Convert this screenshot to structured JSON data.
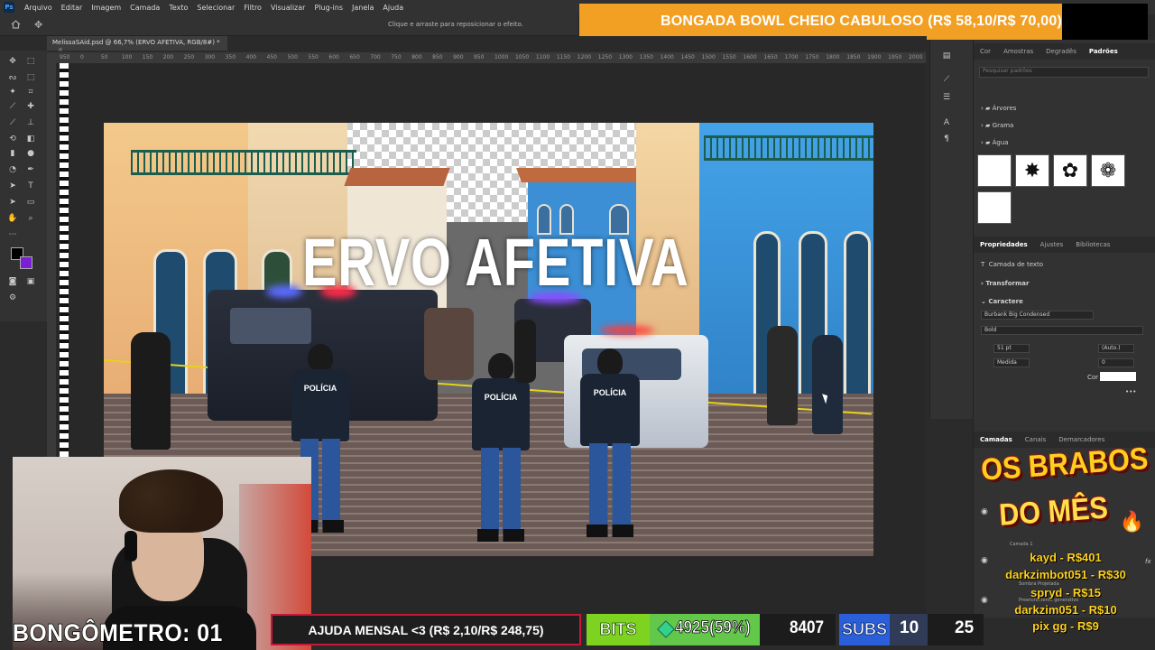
{
  "menubar": {
    "items": [
      "Arquivo",
      "Editar",
      "Imagem",
      "Camada",
      "Texto",
      "Selecionar",
      "Filtro",
      "Visualizar",
      "Plug-ins",
      "Janela",
      "Ajuda"
    ]
  },
  "options_bar": {
    "hint": "Clique e arraste para reposicionar o efeito."
  },
  "banner": {
    "text": "BONGADA BOWL CHEIO CABULOSO (R$ 58,10/R$ 70,00)",
    "color": "#f2a024"
  },
  "document": {
    "tab_title": "MelissaSAid.psd @ 66,7% (ERVO AFETIVA, RGB/8#) *",
    "close_symbol": "×"
  },
  "ruler": {
    "ticks": [
      "950",
      "0",
      "50",
      "100",
      "150",
      "200",
      "250",
      "300",
      "350",
      "400",
      "450",
      "500",
      "550",
      "600",
      "650",
      "700",
      "750",
      "800",
      "850",
      "900",
      "950",
      "1000",
      "1050",
      "1100",
      "1150",
      "1200",
      "1250",
      "1300",
      "1350",
      "1400",
      "1450",
      "1500",
      "1550",
      "1600",
      "1650",
      "1700",
      "1750",
      "1800",
      "1850",
      "1900",
      "1950",
      "2000"
    ]
  },
  "artboard": {
    "headline": "ERVO AFETIVA",
    "vest_label": "POLÍCIA"
  },
  "right_panel": {
    "top_tabs": [
      "Cor",
      "Amostras",
      "Degradês",
      "Padrões"
    ],
    "active_top_tab": "Padrões",
    "search_placeholder": "Pesquisar padrões",
    "folders": [
      "Árvores",
      "Grama",
      "Água"
    ],
    "props_tabs": [
      "Propriedades",
      "Ajustes",
      "Bibliotecas"
    ],
    "layer_kind": "Camada de texto",
    "transform_label": "Transformar",
    "character_label": "Caractere",
    "font_family": "Burbank Big Condensed",
    "font_style": "Bold",
    "font_size": "51 pt",
    "leading": "(Auto.)",
    "kerning": "Medida",
    "tracking": "0",
    "color_label": "Cor",
    "more": "•••",
    "layers_tabs": [
      "Camadas",
      "Canais",
      "Demarcadores"
    ],
    "layer_names": [
      "Camada 1",
      "Sombra Projetada",
      "Preenchimento generativo"
    ],
    "fx": "fx"
  },
  "overlay": {
    "bongometro": "BONGÔMETRO: 01",
    "ajuda": "AJUDA MENSAL <3 (R$ 2,10/R$ 248,75)",
    "bits_label": "BITS",
    "bits_amount": "4925(59%)",
    "bits_goal": "8407",
    "bits_progress": 0.59,
    "subs_label": "SUBS",
    "subs_count": "10",
    "subs_goal": "25",
    "subs_progress": 0.4,
    "brabos_line1": "OS BRABOS",
    "brabos_line2": "DO MÊS",
    "donors": [
      "kayd - R$401",
      "darkzimbot051 - R$30",
      "spryd - R$15",
      "darkzim051 - R$10",
      "pix gg - R$9"
    ]
  }
}
